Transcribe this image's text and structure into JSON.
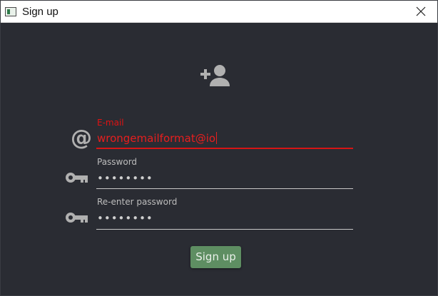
{
  "window": {
    "title": "Sign up",
    "close_icon": "close-icon"
  },
  "form": {
    "header_icon": "add-user-icon",
    "email": {
      "label": "E-mail",
      "value": "wrongemailformat@io",
      "state": "error",
      "icon": "at-icon",
      "error_color": "#e11212"
    },
    "password": {
      "label": "Password",
      "value": "••••••••",
      "icon": "key-icon"
    },
    "reenter_password": {
      "label": "Re-enter password",
      "value": "••••••••",
      "icon": "key-icon"
    },
    "submit_label": "Sign up",
    "submit_color": "#5e8e62"
  },
  "colors": {
    "background": "#2a2c33",
    "accent": "#5e8e62",
    "error": "#e11212"
  }
}
